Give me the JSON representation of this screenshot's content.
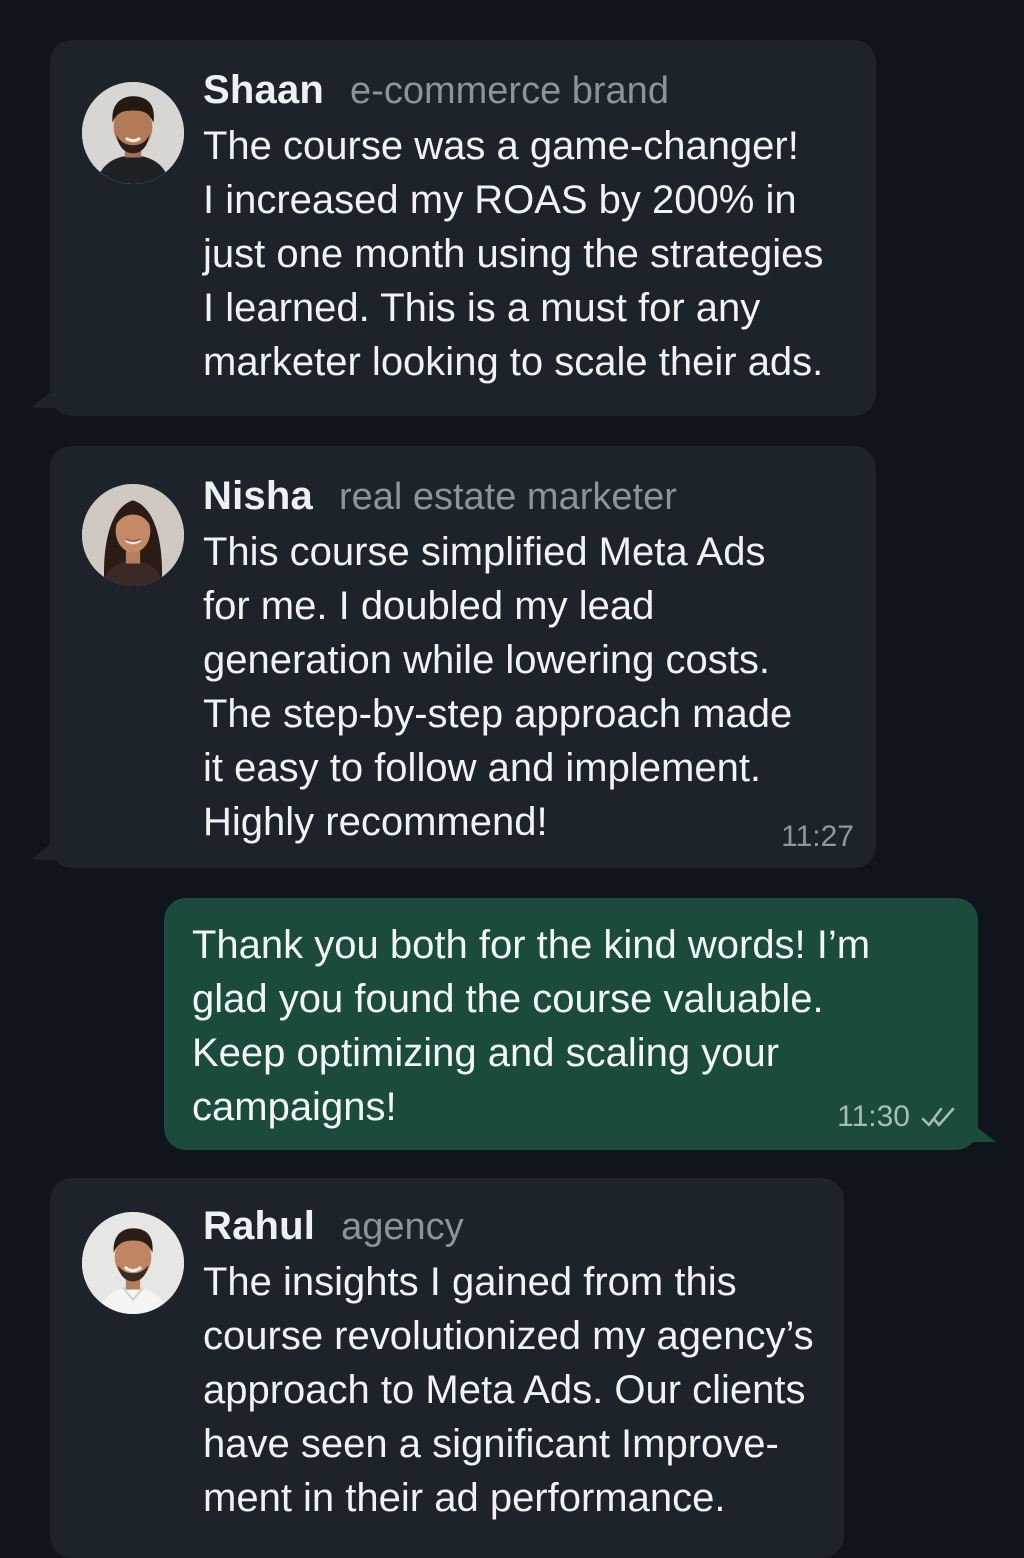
{
  "messages": [
    {
      "sender": "Shaan",
      "role": "e-commerce brand",
      "text": "The course was a game-changer!\nI increased my ROAS by 200% in\njust one month using the strategies\nI learned. This is a must for any\nmarketer looking to scale their ads.",
      "time": ""
    },
    {
      "sender": "Nisha",
      "role": "real estate marketer",
      "text": "This course simplified Meta Ads\nfor me. I doubled my lead\ngeneration while lowering costs.\nThe step-by-step approach made\nit easy to follow and implement.\nHighly recommend!",
      "time": "11:27"
    },
    {
      "text": "Thank you both for the kind words! I’m\nglad you found the course valuable.\nKeep optimizing and scaling your\ncampaigns!",
      "time": "11:30",
      "status_icon": "double-check-icon"
    },
    {
      "sender": "Rahul",
      "role": "agency",
      "text": "The insights I gained from this\ncourse revolutionized my agency’s\napproach to Meta Ads. Our clients\nhave seen a significant Improve-\nment in their ad performance.",
      "time": ""
    }
  ],
  "colors": {
    "background": "#0f151b",
    "incoming_bubble": "#1c232b",
    "outgoing_bubble": "#1a4b3c"
  }
}
